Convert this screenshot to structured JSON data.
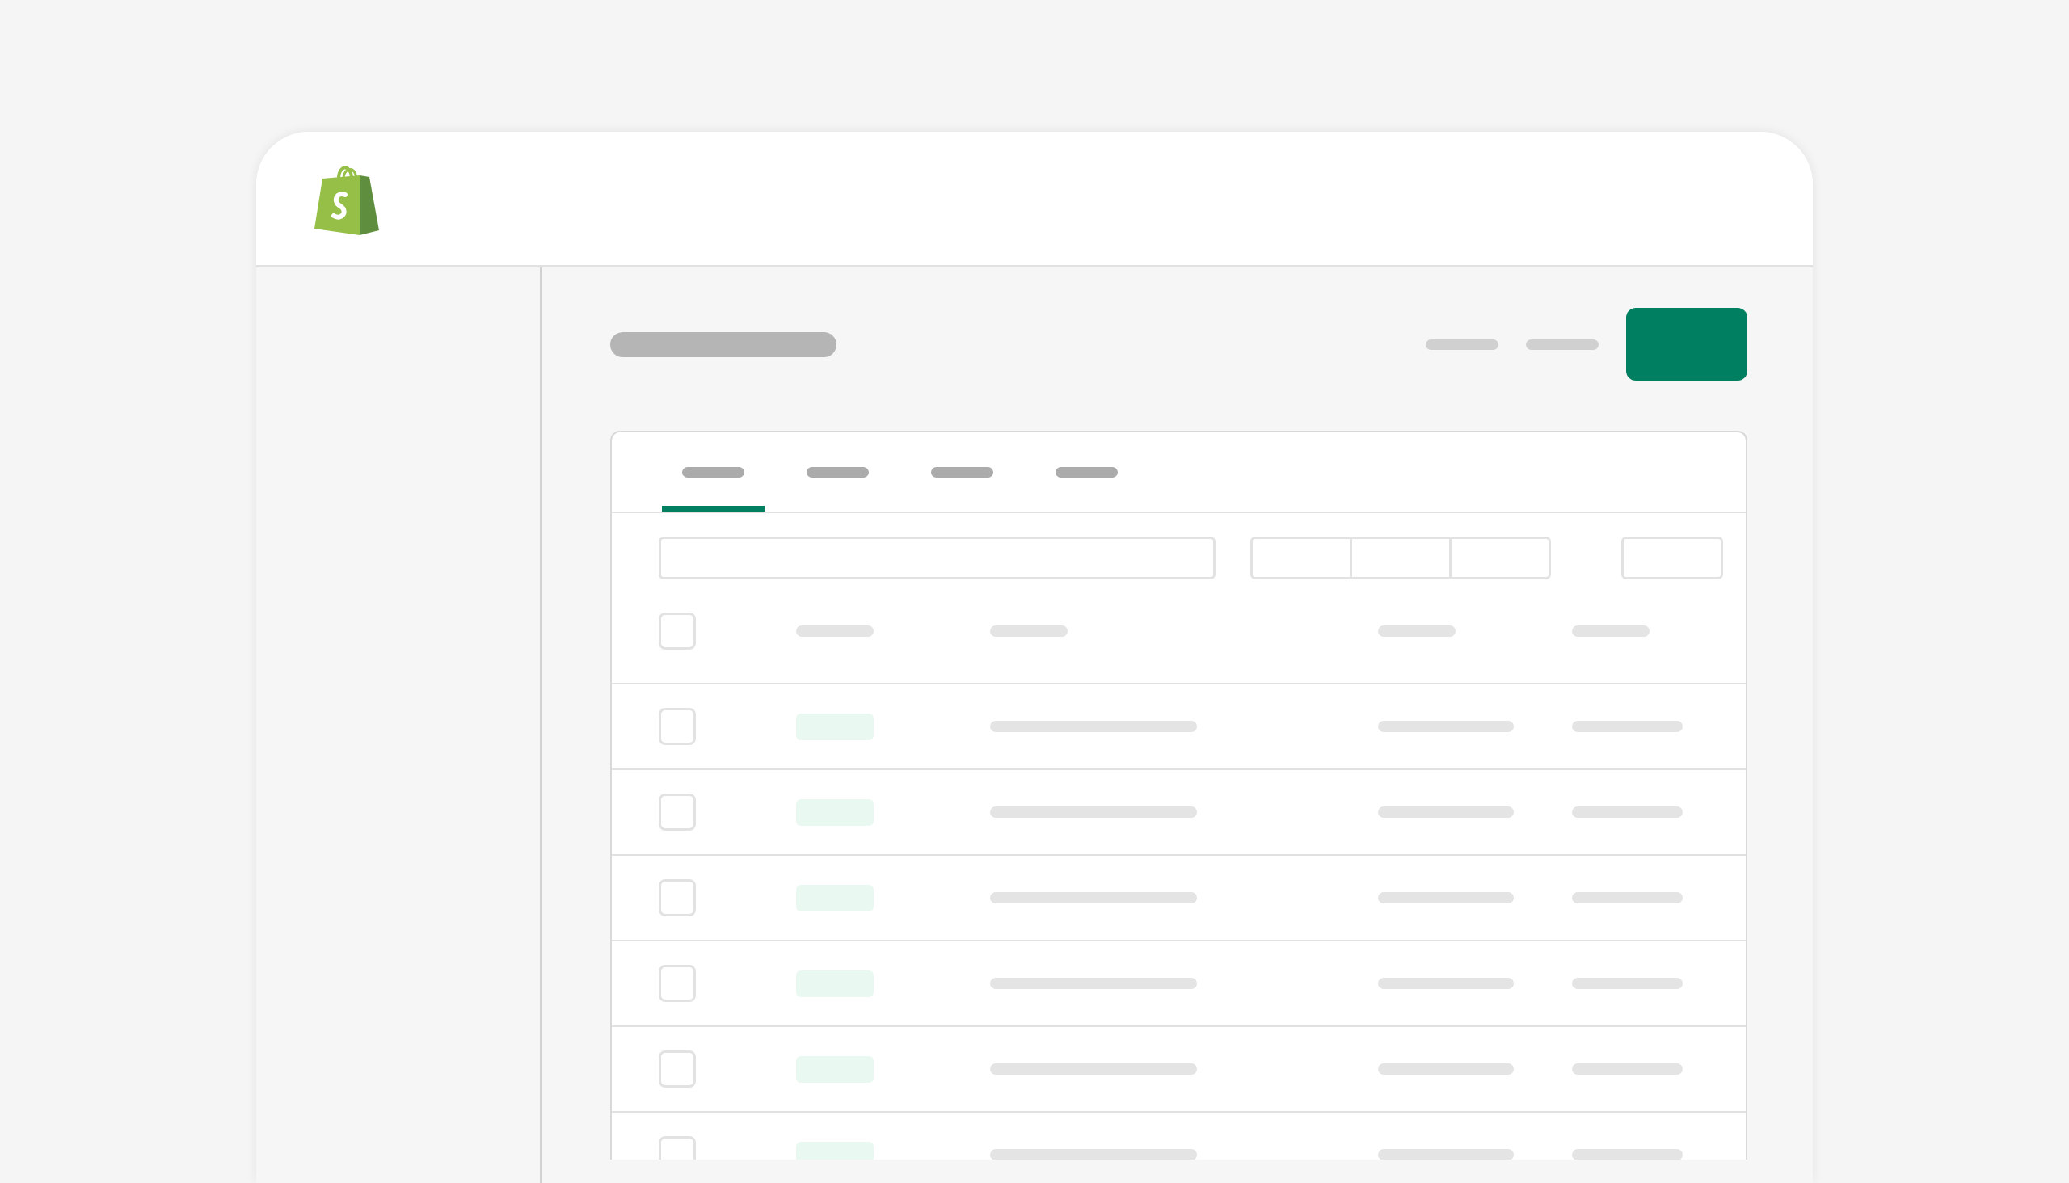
{
  "tabs": [
    {
      "selected": true
    },
    {
      "selected": false
    },
    {
      "selected": false
    },
    {
      "selected": false
    }
  ],
  "table": {
    "header": {
      "checked": false
    },
    "rows": [
      {
        "checked": false
      },
      {
        "checked": false
      },
      {
        "checked": false
      },
      {
        "checked": false
      },
      {
        "checked": false
      },
      {
        "checked": false
      }
    ]
  }
}
